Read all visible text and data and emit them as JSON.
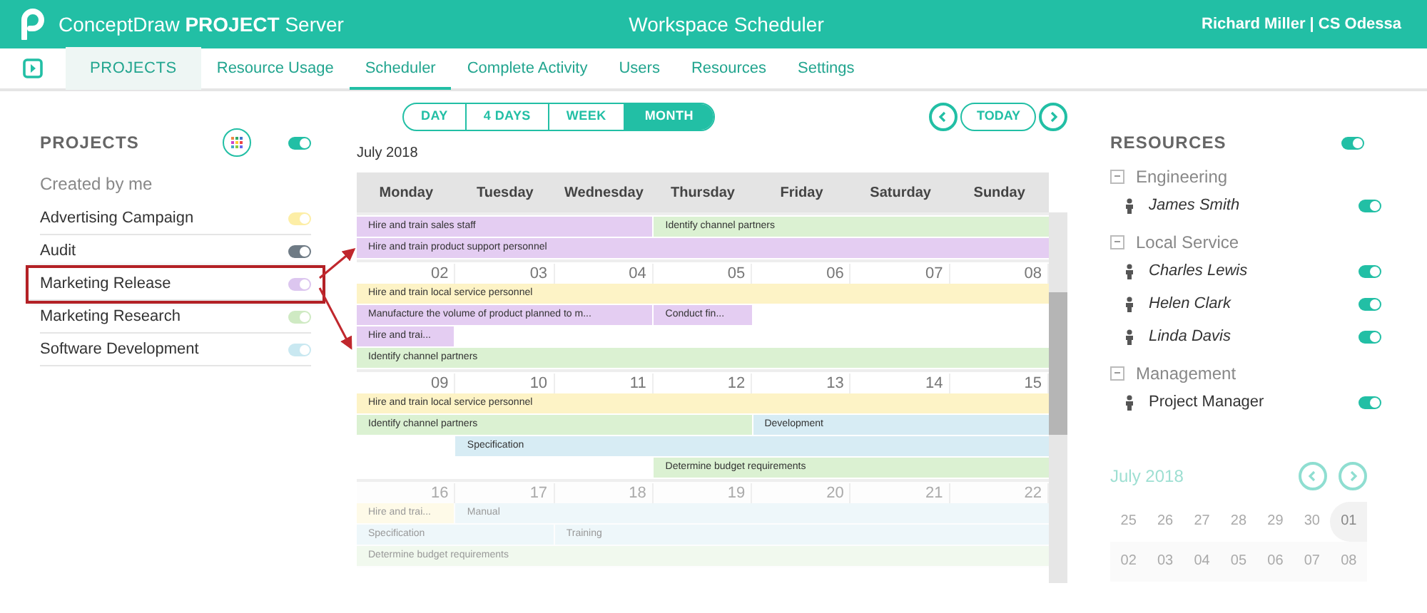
{
  "header": {
    "brand": "ConceptDraw **PROJECT** Server",
    "title": "Workspace Scheduler",
    "user": "Richard Miller | CS Odessa"
  },
  "nav": {
    "section": "PROJECTS",
    "tabs": [
      {
        "label": "Resource Usage",
        "selected": false
      },
      {
        "label": "Scheduler",
        "selected": true
      },
      {
        "label": "Complete Activity",
        "selected": false
      },
      {
        "label": "Users",
        "selected": false
      },
      {
        "label": "Resources",
        "selected": false
      },
      {
        "label": "Settings",
        "selected": false
      }
    ]
  },
  "projects": {
    "title": "PROJECTS",
    "on": true,
    "group": "Created by me",
    "items": [
      {
        "name": "Advertising Campaign",
        "color": "#fdeea6",
        "on": true,
        "highlighted": false
      },
      {
        "name": "Audit",
        "color": "#6f7b85",
        "on": true,
        "highlighted": false
      },
      {
        "name": "Marketing Release",
        "color": "#dcc6ef",
        "on": true,
        "highlighted": true
      },
      {
        "name": "Marketing Research",
        "color": "#cfeac3",
        "on": true,
        "highlighted": false
      },
      {
        "name": "Software Development",
        "color": "#c9e8f1",
        "on": true,
        "highlighted": false
      }
    ]
  },
  "views": [
    {
      "label": "DAY",
      "selected": false
    },
    {
      "label": "4 DAYS",
      "selected": false
    },
    {
      "label": "WEEK",
      "selected": false
    },
    {
      "label": "MONTH",
      "selected": true
    }
  ],
  "today": "TODAY",
  "calendar": {
    "month": "July 2018",
    "days": [
      "Monday",
      "Tuesday",
      "Wednesday",
      "Thursday",
      "Friday",
      "Saturday",
      "Sunday"
    ],
    "weeks": [
      {
        "faded": false,
        "lanes": [
          [
            {
              "title": "Hire and train sales staff",
              "color": "#e4cdf2"
            },
            {
              "title": "Identify channel partners",
              "color": "#dbf1d2"
            }
          ],
          [
            {
              "title": "Hire and train product support personnel",
              "color": "#e4cdf2"
            }
          ]
        ]
      },
      {
        "faded": false,
        "dates": [
          "02",
          "03",
          "04",
          "05",
          "06",
          "07",
          "08"
        ],
        "lanes": [
          [
            {
              "title": "Hire and train local service personnel",
              "color": "#fdf3c6"
            }
          ],
          [
            {
              "title": "Manufacture the volume of product planned to m...",
              "color": "#e4cdf2"
            },
            {
              "title": "Conduct fin...",
              "color": "#e4cdf2"
            }
          ],
          [
            {
              "title": "Hire and trai...",
              "color": "#e4cdf2"
            }
          ],
          [
            {
              "title": "Identify channel partners",
              "color": "#dbf1d2"
            }
          ]
        ]
      },
      {
        "faded": false,
        "dates": [
          "09",
          "10",
          "11",
          "12",
          "13",
          "14",
          "15"
        ],
        "lanes": [
          [
            {
              "title": "Hire and train local service personnel",
              "color": "#fdf3c6"
            }
          ],
          [
            {
              "title": "Identify channel partners",
              "color": "#dbf1d2"
            },
            {
              "title": "Development",
              "color": "#d7ecf4"
            }
          ],
          [
            {
              "title": "Specification",
              "color": "#d7ecf4"
            }
          ],
          [
            {
              "title": "Determine budget requirements",
              "color": "#dbf1d2"
            }
          ]
        ]
      },
      {
        "faded": true,
        "dates": [
          "16",
          "17",
          "18",
          "19",
          "20",
          "21",
          "22"
        ],
        "lanes": [
          [
            {
              "title": "Hire and trai...",
              "color": "#fefae8"
            },
            {
              "title": "Manual",
              "color": "#eef7fa"
            }
          ],
          [
            {
              "title": "Specification",
              "color": "#eef7fa"
            },
            {
              "title": "Training",
              "color": "#eef7fa"
            }
          ],
          [
            {
              "title": "Determine budget requirements",
              "color": "#f1f9ee"
            }
          ]
        ]
      }
    ]
  },
  "resources": {
    "title": "RESOURCES",
    "on": true,
    "groups": [
      {
        "name": "Engineering",
        "expanded": true,
        "children": [
          {
            "name": "James Smith",
            "italic": true,
            "on": true
          }
        ]
      },
      {
        "name": "Local Service",
        "expanded": true,
        "children": [
          {
            "name": "Charles Lewis",
            "italic": true,
            "on": true
          },
          {
            "name": "Helen Clark",
            "italic": true,
            "on": true
          },
          {
            "name": "Linda Davis",
            "italic": true,
            "on": true
          }
        ]
      },
      {
        "name": "Management",
        "expanded": true,
        "children": [
          {
            "name": "Project Manager",
            "italic": false,
            "on": true
          }
        ]
      }
    ]
  },
  "mini_calendar": {
    "month": "July 2018",
    "weeks": [
      [
        {
          "day": "25",
          "selected": false
        },
        {
          "day": "26",
          "selected": false
        },
        {
          "day": "27",
          "selected": false
        },
        {
          "day": "28",
          "selected": false
        },
        {
          "day": "29",
          "selected": false
        },
        {
          "day": "30",
          "selected": false
        },
        {
          "day": "01",
          "selected": true
        }
      ],
      [
        {
          "day": "02",
          "selected": false
        },
        {
          "day": "03",
          "selected": false
        },
        {
          "day": "04",
          "selected": false
        },
        {
          "day": "05",
          "selected": false
        },
        {
          "day": "06",
          "selected": false
        },
        {
          "day": "07",
          "selected": false
        },
        {
          "day": "08",
          "selected": false
        }
      ]
    ]
  }
}
